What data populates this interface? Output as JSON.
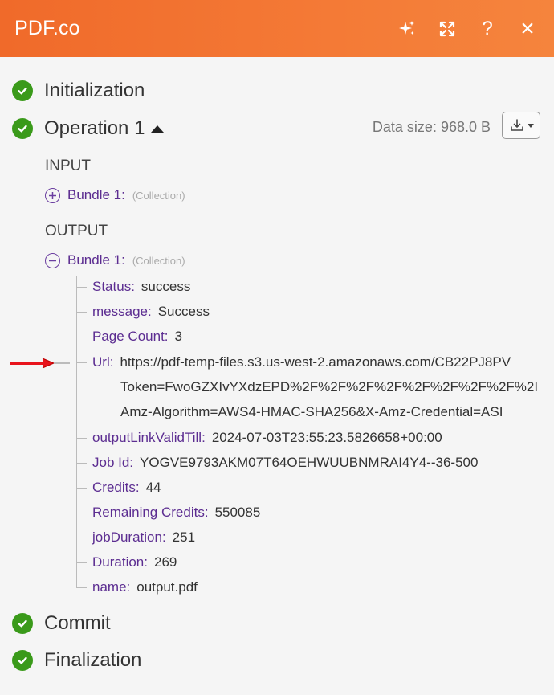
{
  "header": {
    "title": "PDF.co",
    "icons": [
      "sparkle-icon",
      "expand-icon",
      "help-icon",
      "close-icon"
    ],
    "help_glyph": "?",
    "close_glyph": "×"
  },
  "stages": {
    "initialization": "Initialization",
    "operation": "Operation 1",
    "commit": "Commit",
    "finalization": "Finalization"
  },
  "operation": {
    "data_size": "Data size: 968.0 B"
  },
  "input": {
    "label": "INPUT",
    "bundle_label": "Bundle 1:",
    "bundle_type": "(Collection)"
  },
  "output": {
    "label": "OUTPUT",
    "bundle_label": "Bundle 1:",
    "bundle_type": "(Collection)",
    "fields": [
      {
        "key": "Status:",
        "value": "success"
      },
      {
        "key": "message:",
        "value": "Success"
      },
      {
        "key": "Page Count:",
        "value": "3"
      },
      {
        "key": "Url:",
        "value": "https://pdf-temp-files.s3.us-west-2.amazonaws.com/CB22PJ8PV",
        "continuation": [
          "Token=FwoGZXIvYXdzEPD%2F%2F%2F%2F%2F%2F%2F%2F%2I",
          "Amz-Algorithm=AWS4-HMAC-SHA256&X-Amz-Credential=ASI"
        ]
      },
      {
        "key": "outputLinkValidTill:",
        "value": "2024-07-03T23:55:23.5826658+00:00"
      },
      {
        "key": "Job Id:",
        "value": "YOGVE9793AKM07T64OEHWUUBNMRAI4Y4--36-500"
      },
      {
        "key": "Credits:",
        "value": "44"
      },
      {
        "key": "Remaining Credits:",
        "value": "550085"
      },
      {
        "key": "jobDuration:",
        "value": "251"
      },
      {
        "key": "Duration:",
        "value": "269"
      },
      {
        "key": "name:",
        "value": "output.pdf"
      }
    ]
  },
  "colors": {
    "header_start": "#f06a2a",
    "header_end": "#f5843d",
    "success_green": "#3a9a1a",
    "key_purple": "#5c2d91",
    "annotation_arrow": "#e8141c"
  }
}
